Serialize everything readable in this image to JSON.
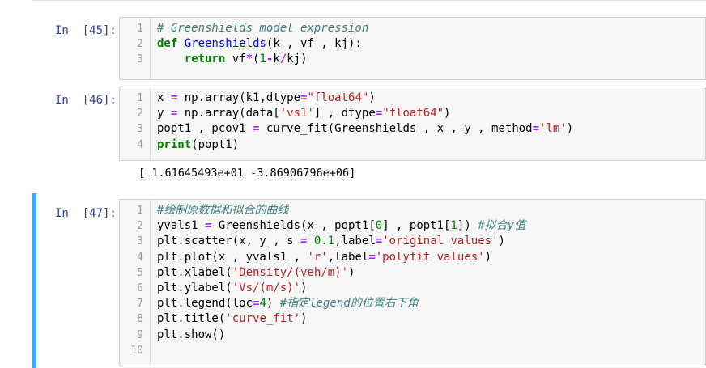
{
  "cells": [
    {
      "prompt": "In  [45]:",
      "line_numbers": [
        "1",
        "2",
        "3"
      ],
      "lines": [
        [
          {
            "t": "# Greenshields model expression",
            "c": "cm"
          }
        ],
        [
          {
            "t": "def",
            "c": "kw"
          },
          {
            "t": " ",
            "c": ""
          },
          {
            "t": "Greenshields",
            "c": "fn"
          },
          {
            "t": "(k , vf , kj):",
            "c": ""
          }
        ],
        [
          {
            "t": "    ",
            "c": ""
          },
          {
            "t": "return",
            "c": "kw"
          },
          {
            "t": " vf",
            "c": ""
          },
          {
            "t": "*",
            "c": "op"
          },
          {
            "t": "(",
            "c": ""
          },
          {
            "t": "1",
            "c": "num"
          },
          {
            "t": "-",
            "c": "op"
          },
          {
            "t": "k",
            "c": ""
          },
          {
            "t": "/",
            "c": "op"
          },
          {
            "t": "kj)",
            "c": ""
          }
        ]
      ],
      "output": ""
    },
    {
      "prompt": "In  [46]:",
      "line_numbers": [
        "1",
        "2",
        "3",
        "4"
      ],
      "lines": [
        [
          {
            "t": "x ",
            "c": ""
          },
          {
            "t": "=",
            "c": "op"
          },
          {
            "t": " np.array(k1,dtype",
            "c": ""
          },
          {
            "t": "=",
            "c": "op"
          },
          {
            "t": "\"float64\"",
            "c": "str"
          },
          {
            "t": ")",
            "c": ""
          }
        ],
        [
          {
            "t": "y ",
            "c": ""
          },
          {
            "t": "=",
            "c": "op"
          },
          {
            "t": " np.array(data[",
            "c": ""
          },
          {
            "t": "'vs1'",
            "c": "str"
          },
          {
            "t": "] , dtype",
            "c": ""
          },
          {
            "t": "=",
            "c": "op"
          },
          {
            "t": "\"float64\"",
            "c": "str"
          },
          {
            "t": ")",
            "c": ""
          }
        ],
        [
          {
            "t": "popt1 , pcov1 ",
            "c": ""
          },
          {
            "t": "=",
            "c": "op"
          },
          {
            "t": " curve_fit(Greenshields , x , y , method",
            "c": ""
          },
          {
            "t": "=",
            "c": "op"
          },
          {
            "t": "'lm'",
            "c": "str"
          },
          {
            "t": ")",
            "c": ""
          }
        ],
        [
          {
            "t": "print",
            "c": "kw"
          },
          {
            "t": "(popt1)",
            "c": ""
          }
        ]
      ],
      "output": "[ 1.61645493e+01 -3.86906796e+06]"
    },
    {
      "prompt": "In  [47]:",
      "line_numbers": [
        "1",
        "2",
        "3",
        "4",
        "5",
        "6",
        "7",
        "8",
        "9",
        "10"
      ],
      "lines": [
        [
          {
            "t": "#绘制原数据和拟合的曲线",
            "c": "cm"
          }
        ],
        [
          {
            "t": "yvals1 ",
            "c": ""
          },
          {
            "t": "=",
            "c": "op"
          },
          {
            "t": " Greenshields(x , popt1[",
            "c": ""
          },
          {
            "t": "0",
            "c": "num"
          },
          {
            "t": "] , popt1[",
            "c": ""
          },
          {
            "t": "1",
            "c": "num"
          },
          {
            "t": "]) ",
            "c": ""
          },
          {
            "t": "#拟合y值",
            "c": "cm"
          }
        ],
        [
          {
            "t": "plt.scatter(x, y , s ",
            "c": ""
          },
          {
            "t": "=",
            "c": "op"
          },
          {
            "t": " ",
            "c": ""
          },
          {
            "t": "0.1",
            "c": "num"
          },
          {
            "t": ",label",
            "c": ""
          },
          {
            "t": "=",
            "c": "op"
          },
          {
            "t": "'original values'",
            "c": "str"
          },
          {
            "t": ")",
            "c": ""
          }
        ],
        [
          {
            "t": "plt.plot(x , yvals1 , ",
            "c": ""
          },
          {
            "t": "'r'",
            "c": "str"
          },
          {
            "t": ",label",
            "c": ""
          },
          {
            "t": "=",
            "c": "op"
          },
          {
            "t": "'polyfit values'",
            "c": "str"
          },
          {
            "t": ")",
            "c": ""
          }
        ],
        [
          {
            "t": "plt.xlabel(",
            "c": ""
          },
          {
            "t": "'Density/(veh/m)'",
            "c": "str"
          },
          {
            "t": ")",
            "c": ""
          }
        ],
        [
          {
            "t": "plt.ylabel(",
            "c": ""
          },
          {
            "t": "'Vs/(m/s)'",
            "c": "str"
          },
          {
            "t": ")",
            "c": ""
          }
        ],
        [
          {
            "t": "plt.legend(loc",
            "c": ""
          },
          {
            "t": "=",
            "c": "op"
          },
          {
            "t": "4",
            "c": "num"
          },
          {
            "t": ") ",
            "c": ""
          },
          {
            "t": "#指定legend的位置右下角",
            "c": "cm"
          }
        ],
        [
          {
            "t": "plt.title(",
            "c": ""
          },
          {
            "t": "'curve_fit'",
            "c": "str"
          },
          {
            "t": ")",
            "c": ""
          }
        ],
        [
          {
            "t": "plt.show()",
            "c": ""
          }
        ],
        []
      ],
      "output": ""
    }
  ],
  "colors": {
    "prompt": "#303f9f",
    "selected_bar": "#42a5f5",
    "keyword": "#008000",
    "function": "#0000ff",
    "comment": "#408080",
    "string": "#ba2121",
    "operator": "#aa22ff"
  }
}
